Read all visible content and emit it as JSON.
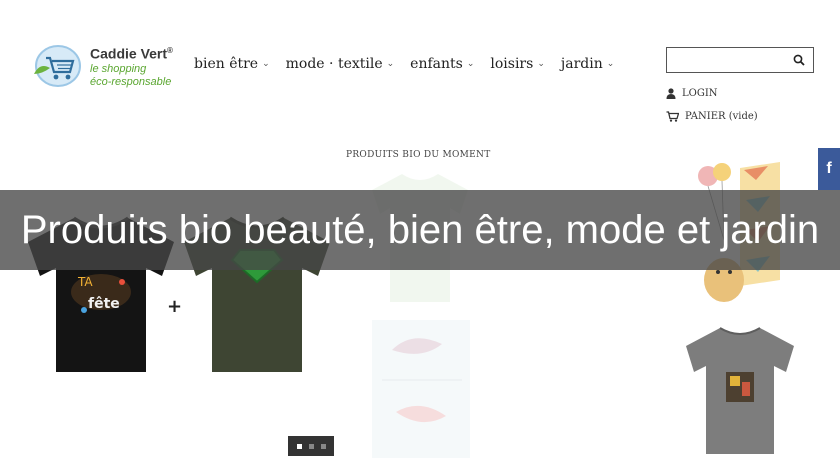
{
  "logo": {
    "name": "Caddie Vert",
    "registered": "®",
    "tagline_1": "le shopping",
    "tagline_2": "éco-responsable"
  },
  "nav": {
    "items": [
      {
        "label": "bien être"
      },
      {
        "label": "mode · textile"
      },
      {
        "label": "enfants"
      },
      {
        "label": "loisirs"
      },
      {
        "label": "jardin"
      }
    ]
  },
  "search": {
    "placeholder": "",
    "value": ""
  },
  "account": {
    "login_label": "LOGIN",
    "cart_label": "PANIER (vide)"
  },
  "section": {
    "title": "PRODUITS BIO DU MOMENT"
  },
  "banner": {
    "title": "Produits bio beauté, bien être, mode et jardin"
  },
  "social": {
    "facebook_label": "f"
  },
  "slider": {
    "pages": 3,
    "active": 1
  },
  "colors": {
    "brand_green": "#5aa630",
    "banner_bg": "#464646",
    "facebook": "#3b5a9a"
  }
}
